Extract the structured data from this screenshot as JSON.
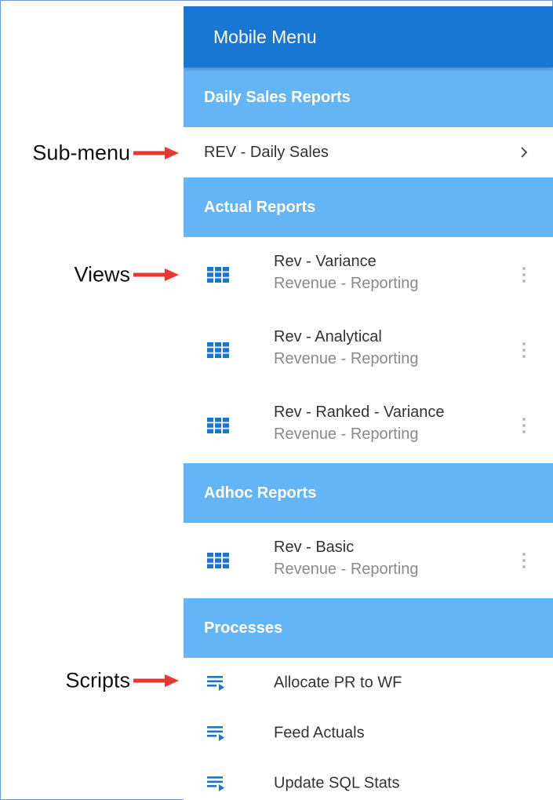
{
  "menu": {
    "title": "Mobile Menu",
    "sections": [
      {
        "title": "Daily Sales Reports"
      },
      {
        "title": "Actual Reports"
      },
      {
        "title": "Adhoc Reports"
      },
      {
        "title": "Processes"
      }
    ],
    "submenu": {
      "label": "REV - Daily Sales"
    },
    "views": [
      {
        "title": "Rev - Variance",
        "subtitle": "Revenue - Reporting"
      },
      {
        "title": "Rev - Analytical",
        "subtitle": "Revenue - Reporting"
      },
      {
        "title": "Rev - Ranked - Variance",
        "subtitle": "Revenue - Reporting"
      },
      {
        "title": "Rev - Basic",
        "subtitle": "Revenue - Reporting"
      }
    ],
    "scripts": [
      {
        "label": "Allocate PR to WF"
      },
      {
        "label": "Feed Actuals"
      },
      {
        "label": "Update SQL Stats"
      }
    ]
  },
  "annotations": {
    "submenu": "Sub-menu",
    "views": "Views",
    "scripts": "Scripts"
  },
  "colors": {
    "header": "#1976d2",
    "section": "#64b5f6",
    "icon": "#1976d2",
    "arrow": "#e53935"
  }
}
